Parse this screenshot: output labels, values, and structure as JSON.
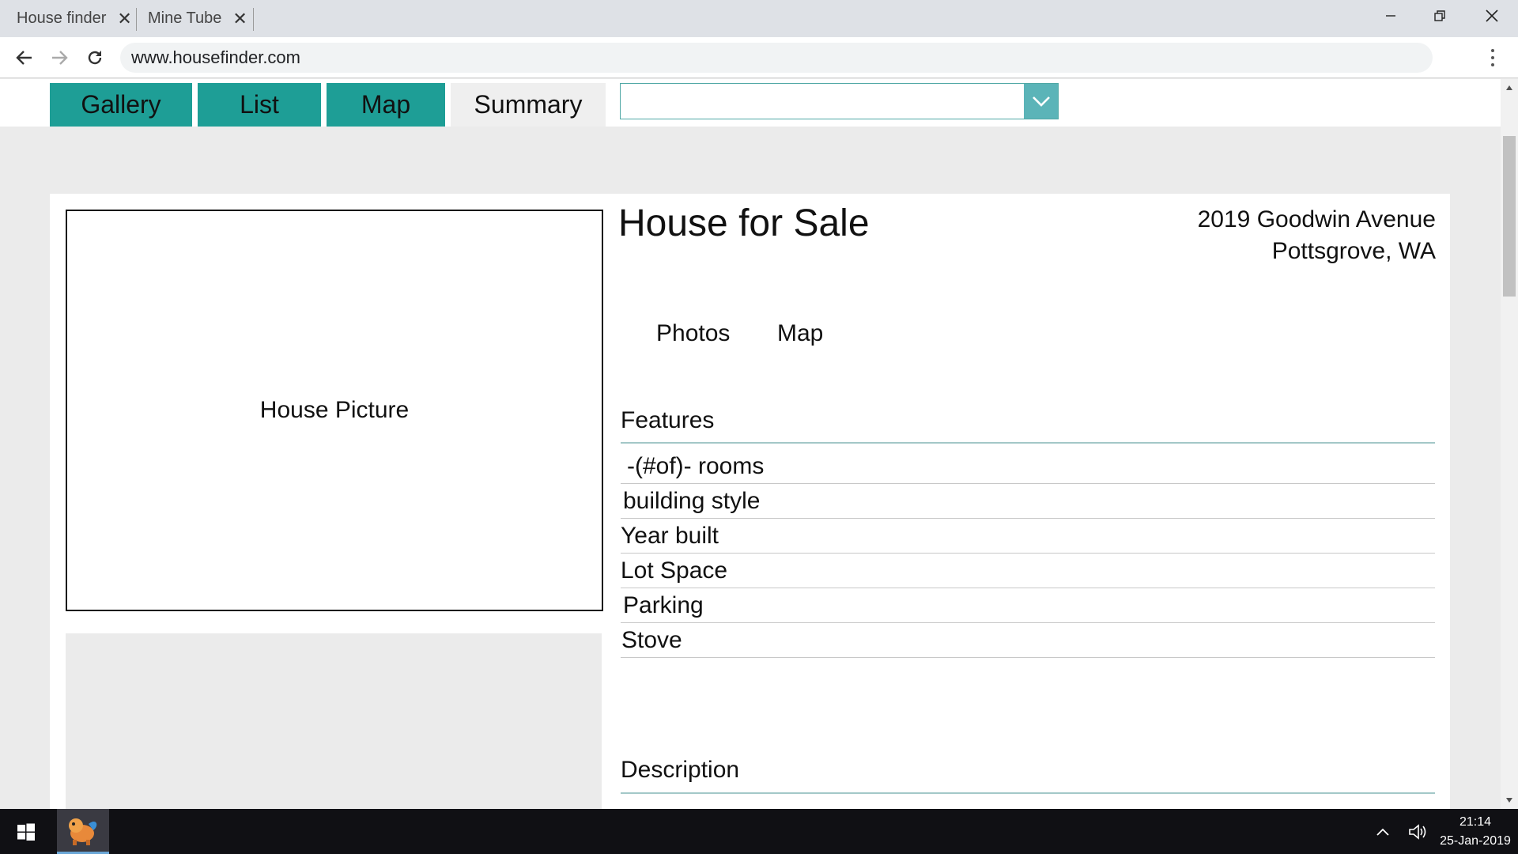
{
  "browser": {
    "tabs": [
      {
        "title": "House finder",
        "close_glyph": "✕"
      },
      {
        "title": "Mine Tube",
        "close_glyph": "✕"
      }
    ],
    "url": "www.housefinder.com",
    "icons": {
      "back": "back-arrow-icon",
      "forward": "forward-arrow-icon",
      "reload": "reload-icon",
      "menu": "kebab-menu-icon",
      "minimize": "minimize-icon",
      "restore": "restore-icon",
      "close": "close-icon"
    }
  },
  "page": {
    "nav_tabs": [
      {
        "label": "Gallery",
        "state": "teal"
      },
      {
        "label": "List",
        "state": "teal"
      },
      {
        "label": "Map",
        "state": "teal"
      },
      {
        "label": "Summary",
        "state": "active"
      }
    ],
    "filter": {
      "value": ""
    },
    "listing": {
      "picture_label": "House Picture",
      "title": "House for Sale",
      "address_line1": "2019 Goodwin Avenue",
      "address_line2": "Pottsgrove, WA",
      "subtabs": [
        "Photos",
        "Map"
      ],
      "features_title": "Features",
      "features": [
        " -(#of)- rooms",
        "building style",
        " Year built",
        " Lot Space",
        "Parking",
        "Stove"
      ],
      "description_title": "Description"
    }
  },
  "taskbar": {
    "time": "21:14",
    "date": "25-Jan-2019"
  },
  "colors": {
    "accent_teal": "#1e9e96",
    "dropdown_arrow": "#5bb4b8",
    "active_tab": "#efefef",
    "taskbar": "#101014"
  }
}
